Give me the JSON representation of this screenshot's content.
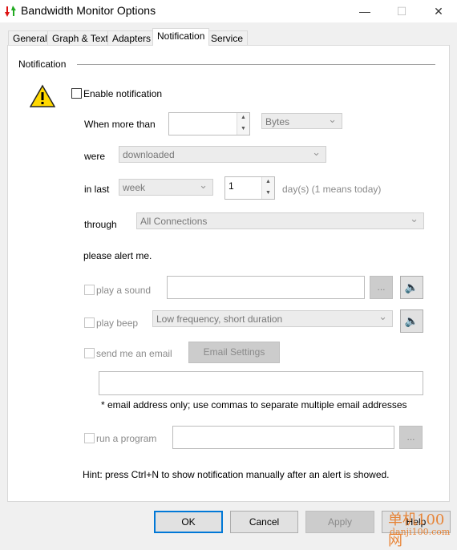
{
  "window": {
    "title": "Bandwidth Monitor Options",
    "minimize": "—",
    "maximize": "☐",
    "close": "✕"
  },
  "tabs": [
    {
      "label": "General"
    },
    {
      "label": "Graph & Text"
    },
    {
      "label": "Adapters"
    },
    {
      "label": "Notification",
      "active": true
    },
    {
      "label": "Service"
    }
  ],
  "section": {
    "title": "Notification"
  },
  "enable": {
    "label": "Enable notification",
    "checked": false
  },
  "when": {
    "label": "When more than",
    "value": "",
    "unit": "Bytes"
  },
  "were": {
    "label": "were",
    "value": "downloaded"
  },
  "inlast": {
    "label": "in last",
    "period": "week",
    "count": "1",
    "hint": "day(s) (1 means today)"
  },
  "through": {
    "label": "through",
    "value": "All Connections"
  },
  "alert": {
    "label": "please alert me."
  },
  "sound": {
    "label": "play a sound",
    "value": "",
    "browse": "..."
  },
  "beep": {
    "label": "play beep",
    "value": "Low frequency, short duration"
  },
  "email": {
    "label": "send me an email",
    "settings": "Email Settings",
    "value": "",
    "note": "* email address only; use commas to separate multiple email addresses"
  },
  "program": {
    "label": "run a program",
    "value": "",
    "browse": "..."
  },
  "hint": "Hint: press Ctrl+N to show notification manually after an alert is showed.",
  "buttons": {
    "ok": "OK",
    "cancel": "Cancel",
    "apply": "Apply",
    "help": "Help"
  },
  "watermark": {
    "text": "单机100网",
    "url_text": "danji100.com"
  },
  "colors": {
    "accent": "#0078d7",
    "warning": "#ffd800"
  }
}
